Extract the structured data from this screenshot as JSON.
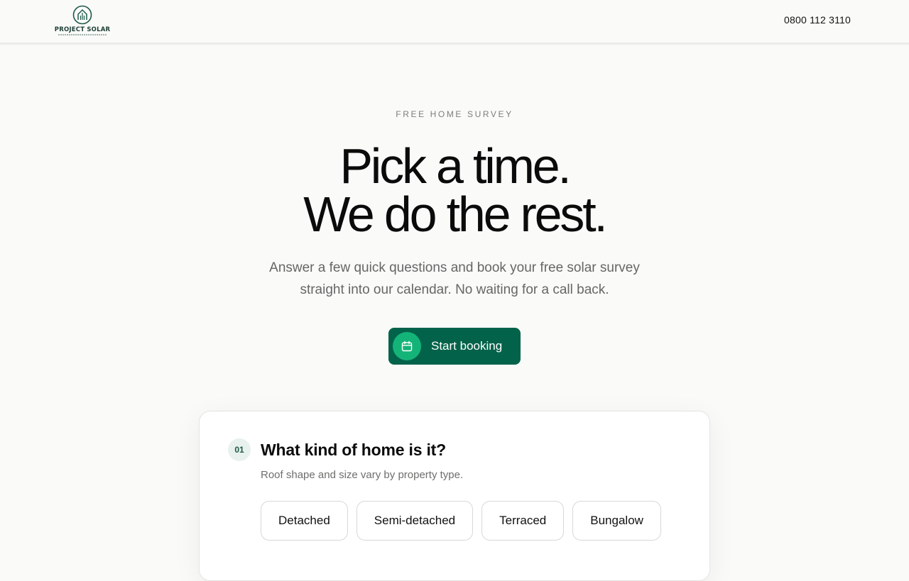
{
  "header": {
    "logo_text": "PROJECT SOLAR",
    "phone": "0800 112 3110"
  },
  "hero": {
    "eyebrow": "FREE HOME SURVEY",
    "headline": [
      "Pick a time.",
      "We do the rest."
    ],
    "subtitle": [
      "Answer a few quick questions and book your free solar survey",
      "straight into our calendar. No waiting for a call back."
    ],
    "cta_label": "Start booking",
    "cta_icon": "calendar-icon"
  },
  "step": {
    "number": "01",
    "question": "What kind of home is it?",
    "hint": "Roof shape and size vary by property type.",
    "options": [
      "Detached",
      "Semi-detached",
      "Terraced",
      "Bungalow"
    ]
  },
  "colors": {
    "brand_green": "#03634a",
    "accent_green": "#14b478",
    "badge_bg": "#e8f1ee",
    "page_bg": "#fafaf8"
  }
}
